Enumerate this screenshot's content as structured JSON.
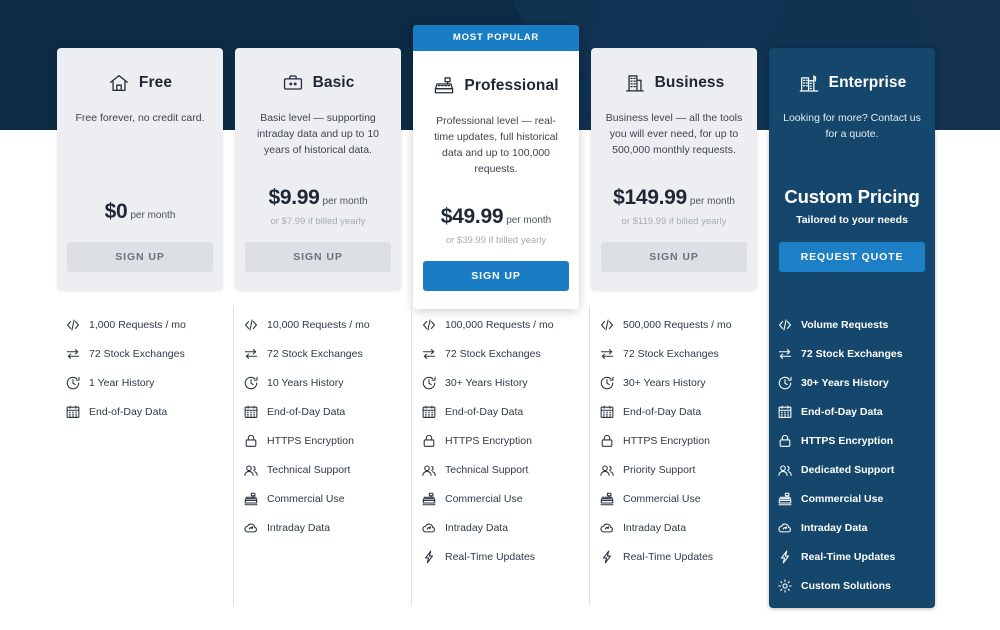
{
  "theme": {
    "header_bg": "#0d2b45",
    "accent": "#1a7dc4",
    "card_bg": "#eceef2",
    "featured_bg": "#ffffff",
    "enterprise_bg": "#14476b",
    "grey_button": "#dcdfe4"
  },
  "plans": [
    {
      "id": "free",
      "badge": null,
      "icon": "home-icon",
      "title": "Free",
      "description": "Free forever, no credit card.",
      "price": "$0",
      "period": "per month",
      "yearly": null,
      "cta_label": "SIGN UP",
      "cta_style": "grey",
      "features": [
        {
          "icon": "code-icon",
          "label": "1,000 Requests / mo"
        },
        {
          "icon": "exchange-icon",
          "label": "72 Stock Exchanges"
        },
        {
          "icon": "clock-icon",
          "label": "1 Year History"
        },
        {
          "icon": "calendar-icon",
          "label": "End-of-Day Data"
        }
      ]
    },
    {
      "id": "basic",
      "badge": null,
      "icon": "briefcase-icon",
      "title": "Basic",
      "description": "Basic level — supporting intraday data and up to 10 years of historical data.",
      "price": "$9.99",
      "period": "per month",
      "yearly": "or $7.99 if billed yearly",
      "cta_label": "SIGN UP",
      "cta_style": "grey",
      "features": [
        {
          "icon": "code-icon",
          "label": "10,000 Requests / mo"
        },
        {
          "icon": "exchange-icon",
          "label": "72 Stock Exchanges"
        },
        {
          "icon": "clock-icon",
          "label": "10 Years History"
        },
        {
          "icon": "calendar-icon",
          "label": "End-of-Day Data"
        },
        {
          "icon": "lock-icon",
          "label": "HTTPS Encryption"
        },
        {
          "icon": "users-icon",
          "label": "Technical Support"
        },
        {
          "icon": "register-icon",
          "label": "Commercial Use"
        },
        {
          "icon": "cloud-refresh-icon",
          "label": "Intraday Data"
        }
      ]
    },
    {
      "id": "professional",
      "badge": "MOST POPULAR",
      "icon": "cash-register-icon",
      "title": "Professional",
      "description": "Professional level — real-time updates, full historical data and up to 100,000 requests.",
      "price": "$49.99",
      "period": "per month",
      "yearly": "or $39.99 if billed yearly",
      "cta_label": "SIGN UP",
      "cta_style": "blue",
      "features": [
        {
          "icon": "code-icon",
          "label": "100,000 Requests / mo"
        },
        {
          "icon": "exchange-icon",
          "label": "72 Stock Exchanges"
        },
        {
          "icon": "clock-icon",
          "label": "30+ Years History"
        },
        {
          "icon": "calendar-icon",
          "label": "End-of-Day Data"
        },
        {
          "icon": "lock-icon",
          "label": "HTTPS Encryption"
        },
        {
          "icon": "users-icon",
          "label": "Technical Support"
        },
        {
          "icon": "register-icon",
          "label": "Commercial Use"
        },
        {
          "icon": "cloud-refresh-icon",
          "label": "Intraday Data"
        },
        {
          "icon": "bolt-icon",
          "label": "Real-Time Updates"
        }
      ]
    },
    {
      "id": "business",
      "badge": null,
      "icon": "building-icon",
      "title": "Business",
      "description": "Business level — all the tools you will ever need, for up to 500,000 monthly requests.",
      "price": "$149.99",
      "period": "per month",
      "yearly": "or $119.99 if billed yearly",
      "cta_label": "SIGN UP",
      "cta_style": "grey",
      "features": [
        {
          "icon": "code-icon",
          "label": "500,000 Requests / mo"
        },
        {
          "icon": "exchange-icon",
          "label": "72 Stock Exchanges"
        },
        {
          "icon": "clock-icon",
          "label": "30+ Years History"
        },
        {
          "icon": "calendar-icon",
          "label": "End-of-Day Data"
        },
        {
          "icon": "lock-icon",
          "label": "HTTPS Encryption"
        },
        {
          "icon": "users-icon",
          "label": "Priority Support"
        },
        {
          "icon": "register-icon",
          "label": "Commercial Use"
        },
        {
          "icon": "cloud-refresh-icon",
          "label": "Intraday Data"
        },
        {
          "icon": "bolt-icon",
          "label": "Real-Time Updates"
        }
      ]
    },
    {
      "id": "enterprise",
      "badge": null,
      "icon": "city-icon",
      "title": "Enterprise",
      "description": "Looking for more? Contact us for a quote.",
      "price": "Custom Pricing",
      "period": "Tailored to your needs",
      "yearly": null,
      "cta_label": "REQUEST QUOTE",
      "cta_style": "blue",
      "features": [
        {
          "icon": "code-icon",
          "label": "Volume Requests"
        },
        {
          "icon": "exchange-icon",
          "label": "72 Stock Exchanges"
        },
        {
          "icon": "clock-icon",
          "label": "30+ Years History"
        },
        {
          "icon": "calendar-icon",
          "label": "End-of-Day Data"
        },
        {
          "icon": "lock-icon",
          "label": "HTTPS Encryption"
        },
        {
          "icon": "users-icon",
          "label": "Dedicated Support"
        },
        {
          "icon": "register-icon",
          "label": "Commercial Use"
        },
        {
          "icon": "cloud-refresh-icon",
          "label": "Intraday Data"
        },
        {
          "icon": "bolt-icon",
          "label": "Real-Time Updates"
        },
        {
          "icon": "gear-icon",
          "label": "Custom Solutions"
        }
      ]
    }
  ]
}
